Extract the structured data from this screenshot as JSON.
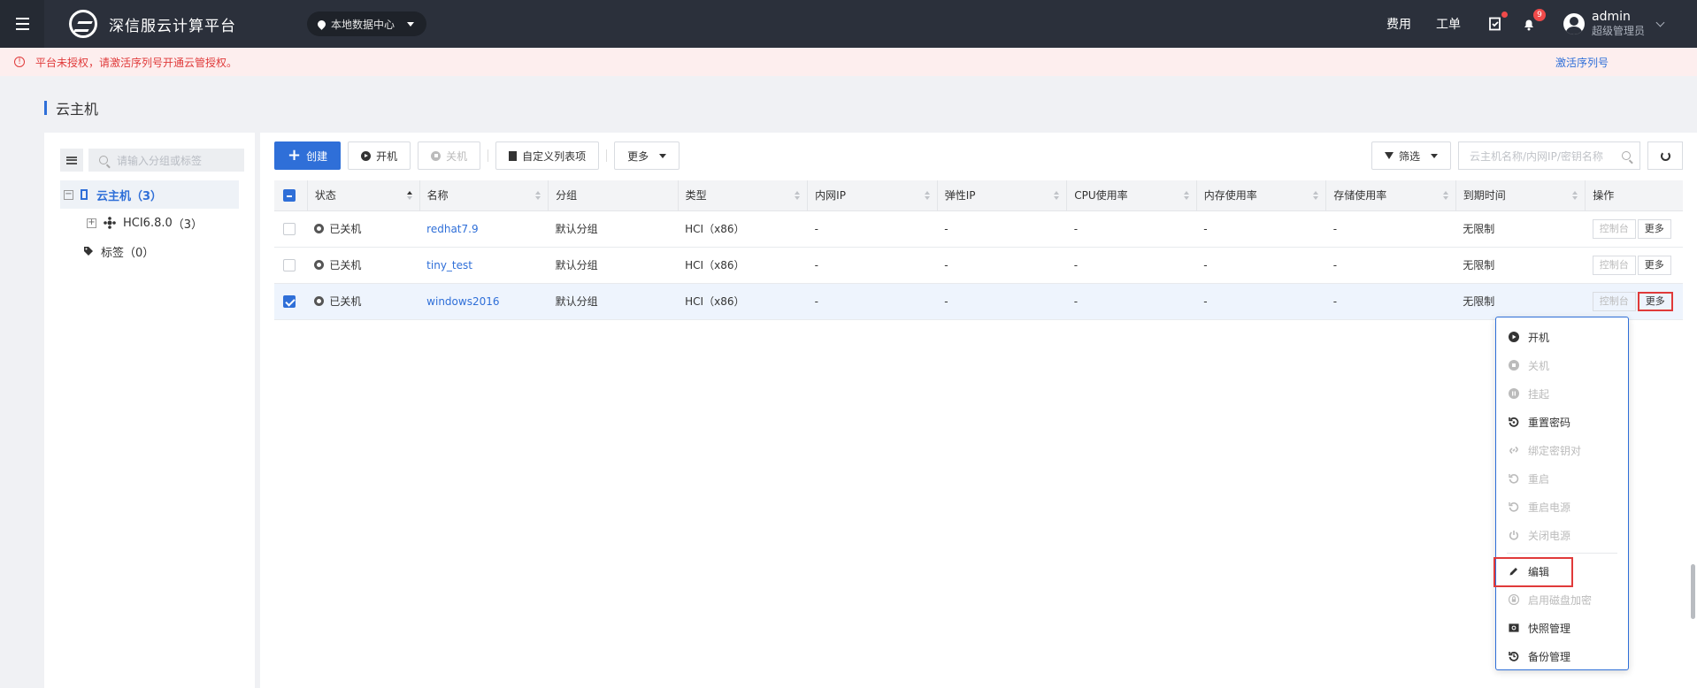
{
  "topbar": {
    "brand": "深信服云计算平台",
    "datacenter": "本地数据中心",
    "links": [
      "费用",
      "工单"
    ],
    "notification_count": "9",
    "user_name": "admin",
    "user_role": "超级管理员",
    "icons": [
      "menu-icon",
      "logo-icon",
      "location-pin-icon",
      "task-icon",
      "bell-icon",
      "user-avatar-icon",
      "chevron-down-icon"
    ]
  },
  "alert": {
    "message": "平台未授权，请激活序列号开通云管授权。",
    "action": "激活序列号"
  },
  "page": {
    "title": "云主机"
  },
  "tree": {
    "search_placeholder": "请输入分组或标签",
    "nodes": [
      {
        "label": "云主机",
        "count": "（3）"
      },
      {
        "label": "HCI6.8.0",
        "count": "（3）"
      },
      {
        "label": "标签",
        "count": "（0）"
      }
    ]
  },
  "toolbar": {
    "create": "创建",
    "power_on": "开机",
    "power_off": "关机",
    "custom_columns": "自定义列表项",
    "more": "更多",
    "filter": "筛选",
    "search_placeholder": "云主机名称/内网IP/密钥名称"
  },
  "table": {
    "columns": [
      "状态",
      "名称",
      "分组",
      "类型",
      "内网IP",
      "弹性IP",
      "CPU使用率",
      "内存使用率",
      "存储使用率",
      "到期时间",
      "操作"
    ],
    "rows": [
      {
        "status": "已关机",
        "name": "redhat7.9",
        "group": "默认分组",
        "type": "HCI（x86）",
        "ip": "-",
        "eip": "-",
        "cpu": "-",
        "mem": "-",
        "storage": "-",
        "expire": "无限制",
        "console": "控制台",
        "more": "更多",
        "checked": false
      },
      {
        "status": "已关机",
        "name": "tiny_test",
        "group": "默认分组",
        "type": "HCI（x86）",
        "ip": "-",
        "eip": "-",
        "cpu": "-",
        "mem": "-",
        "storage": "-",
        "expire": "无限制",
        "console": "控制台",
        "more": "更多",
        "checked": false
      },
      {
        "status": "已关机",
        "name": "windows2016",
        "group": "默认分组",
        "type": "HCI（x86）",
        "ip": "-",
        "eip": "-",
        "cpu": "-",
        "mem": "-",
        "storage": "-",
        "expire": "无限制",
        "console": "控制台",
        "more": "更多",
        "checked": true
      }
    ]
  },
  "menu": {
    "items": [
      {
        "label": "开机",
        "icon": "play-icon",
        "disabled": false
      },
      {
        "label": "关机",
        "icon": "stop-icon",
        "disabled": true
      },
      {
        "label": "挂起",
        "icon": "pause-icon",
        "disabled": true
      },
      {
        "label": "重置密码",
        "icon": "reset-icon",
        "disabled": false
      },
      {
        "label": "绑定密钥对",
        "icon": "link-icon",
        "disabled": true
      },
      {
        "label": "重启",
        "icon": "restart-icon",
        "disabled": true
      },
      {
        "label": "重启电源",
        "icon": "restart-icon",
        "disabled": true
      },
      {
        "label": "关闭电源",
        "icon": "power-icon",
        "disabled": true
      },
      {
        "label": "编辑",
        "icon": "pencil-icon",
        "disabled": false
      },
      {
        "label": "启用磁盘加密",
        "icon": "lock-icon",
        "disabled": true
      },
      {
        "label": "快照管理",
        "icon": "camera-icon",
        "disabled": false
      },
      {
        "label": "备份管理",
        "icon": "backup-icon",
        "disabled": false
      }
    ]
  },
  "colors": {
    "accent": "#2f6fd8",
    "topbar": "#2b303b",
    "alert": "#e03a3a",
    "highlight": "#e03a3a"
  }
}
